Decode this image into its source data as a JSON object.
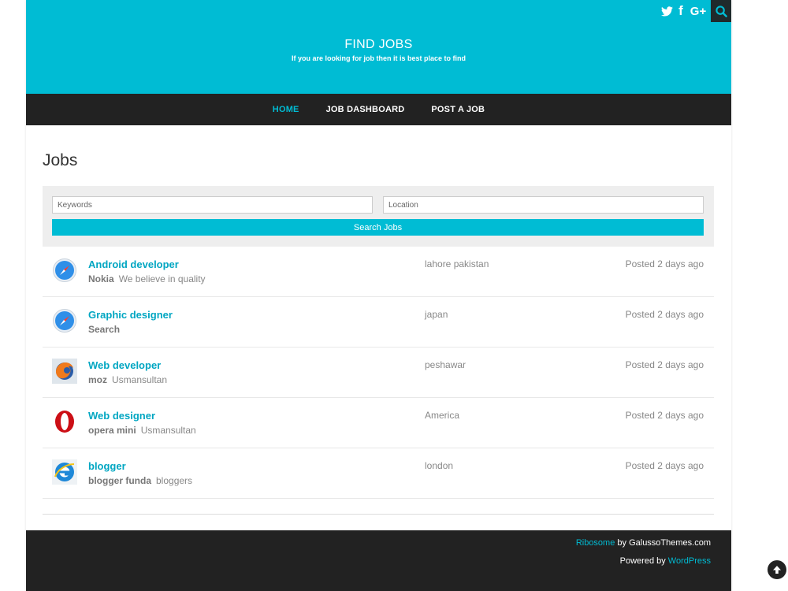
{
  "header": {
    "site_title": "FIND JOBS",
    "site_description": "If you are looking for job then it is best place to find",
    "social": {
      "twitter_icon": "twitter-icon",
      "facebook_glyph": "f",
      "googleplus_glyph": "G+",
      "search_icon": "search-icon"
    }
  },
  "nav": {
    "items": [
      {
        "label": "HOME",
        "active": true
      },
      {
        "label": "JOB DASHBOARD",
        "active": false
      },
      {
        "label": "POST A JOB",
        "active": false
      }
    ]
  },
  "main": {
    "page_title": "Jobs",
    "search": {
      "keywords_placeholder": "Keywords",
      "location_placeholder": "Location",
      "button_label": "Search Jobs"
    },
    "jobs": [
      {
        "title": "Android developer",
        "company": "Nokia",
        "tagline": "We believe in quality",
        "location": "lahore pakistan",
        "posted": "Posted 2 days ago",
        "logo": "safari-compass-icon"
      },
      {
        "title": "Graphic designer",
        "company": "Search",
        "tagline": "",
        "location": "japan",
        "posted": "Posted 2 days ago",
        "logo": "safari-compass-icon"
      },
      {
        "title": "Web developer",
        "company": "moz",
        "tagline": "Usmansultan",
        "location": "peshawar",
        "posted": "Posted 2 days ago",
        "logo": "firefox-icon"
      },
      {
        "title": "Web designer",
        "company": "opera mini",
        "tagline": "Usmansultan",
        "location": "America",
        "posted": "Posted 2 days ago",
        "logo": "opera-icon"
      },
      {
        "title": "blogger",
        "company": "blogger funda",
        "tagline": "bloggers",
        "location": "london",
        "posted": "Posted 2 days ago",
        "logo": "internet-explorer-icon"
      }
    ]
  },
  "footer": {
    "theme_link": "Ribosome",
    "theme_by": " by GalussoThemes.com",
    "powered_by": "Powered by ",
    "wordpress_link": "WordPress"
  },
  "colors": {
    "accent": "#00bcd4",
    "dark": "#222222",
    "text_muted": "#888888"
  }
}
